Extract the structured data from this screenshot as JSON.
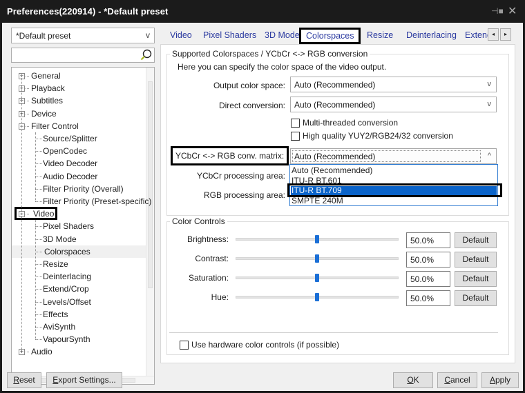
{
  "window": {
    "title": "Preferences(220914) - *Default preset",
    "pin_icon": "pin-icon",
    "close_icon": "close-icon"
  },
  "left": {
    "preset_select": {
      "value": "*Default preset",
      "arrow": "v"
    },
    "search": {
      "value": "",
      "placeholder": "",
      "icon": "search-icon"
    },
    "tree": [
      {
        "label": "General",
        "level": 0,
        "expander": "+"
      },
      {
        "label": "Playback",
        "level": 0,
        "expander": "+"
      },
      {
        "label": "Subtitles",
        "level": 0,
        "expander": "+"
      },
      {
        "label": "Device",
        "level": 0,
        "expander": "+"
      },
      {
        "label": "Filter Control",
        "level": 0,
        "expander": "-"
      },
      {
        "label": "Source/Splitter",
        "level": 1
      },
      {
        "label": "OpenCodec",
        "level": 1
      },
      {
        "label": "Video Decoder",
        "level": 1
      },
      {
        "label": "Audio Decoder",
        "level": 1
      },
      {
        "label": "Filter Priority (Overall)",
        "level": 1
      },
      {
        "label": "Filter Priority (Preset-specific)",
        "level": 1
      },
      {
        "label": "Video",
        "level": 0,
        "expander": "-",
        "highlighted": true
      },
      {
        "label": "Pixel Shaders",
        "level": 1
      },
      {
        "label": "3D Mode",
        "level": 1
      },
      {
        "label": "Colorspaces",
        "level": 1,
        "selected": true
      },
      {
        "label": "Resize",
        "level": 1
      },
      {
        "label": "Deinterlacing",
        "level": 1
      },
      {
        "label": "Extend/Crop",
        "level": 1
      },
      {
        "label": "Levels/Offset",
        "level": 1
      },
      {
        "label": "Effects",
        "level": 1
      },
      {
        "label": "AviSynth",
        "level": 1
      },
      {
        "label": "VapourSynth",
        "level": 1
      },
      {
        "label": "Audio",
        "level": 0,
        "expander": "+"
      }
    ]
  },
  "tabs": {
    "items": [
      {
        "label": "Video"
      },
      {
        "label": "Pixel Shaders"
      },
      {
        "label": "3D Mode"
      },
      {
        "label": "Colorspaces",
        "active": true
      },
      {
        "label": "Resize"
      },
      {
        "label": "Deinterlacing"
      },
      {
        "label": "Extend"
      }
    ],
    "scroll_left": "◂",
    "scroll_right": "▸"
  },
  "colorspaces": {
    "group_title": "Supported Colorspaces / YCbCr <-> RGB conversion",
    "description": "Here you can specify the color space of the video output.",
    "output_color_space": {
      "label": "Output color space:",
      "value": "Auto (Recommended)",
      "arrow": "v"
    },
    "direct_conversion": {
      "label": "Direct conversion:",
      "value": "Auto (Recommended)",
      "arrow": "v"
    },
    "multithreaded": {
      "label": "Multi-threaded conversion",
      "checked": false
    },
    "high_quality": {
      "label": "High quality YUY2/RGB24/32 conversion",
      "checked": false
    },
    "matrix": {
      "label": "YCbCr <-> RGB conv. matrix:",
      "value": "Auto (Recommended)",
      "arrow": "^",
      "options": [
        "Auto (Recommended)",
        "ITU-R BT.601",
        "ITU-R BT.709",
        "SMPTE 240M"
      ],
      "highlighted_option": "ITU-R BT.709"
    },
    "ycbcr_area": {
      "label": "YCbCr processing area:"
    },
    "rgb_area": {
      "label": "RGB processing area:"
    }
  },
  "color_controls": {
    "group_title": "Color Controls",
    "rows": [
      {
        "label": "Brightness:",
        "value": "50.0%",
        "fraction": 0.5,
        "button": "Default"
      },
      {
        "label": "Contrast:",
        "value": "50.0%",
        "fraction": 0.5,
        "button": "Default"
      },
      {
        "label": "Saturation:",
        "value": "50.0%",
        "fraction": 0.5,
        "button": "Default"
      },
      {
        "label": "Hue:",
        "value": "50.0%",
        "fraction": 0.5,
        "button": "Default"
      }
    ],
    "hardware": {
      "label": "Use hardware color controls (if possible)",
      "checked": false
    }
  },
  "footer": {
    "reset": {
      "label": "Reset",
      "mnemonic": "R"
    },
    "export": {
      "label": "Export Settings...",
      "mnemonic": "E"
    },
    "ok": {
      "label": "OK",
      "mnemonic": "O"
    },
    "cancel": {
      "label": "Cancel",
      "mnemonic": "C"
    },
    "apply": {
      "label": "Apply",
      "mnemonic": "A"
    }
  },
  "colors": {
    "accent": "#0a63c9",
    "tab_text": "#2b3aa0",
    "slider_thumb": "#1b6fd6"
  }
}
